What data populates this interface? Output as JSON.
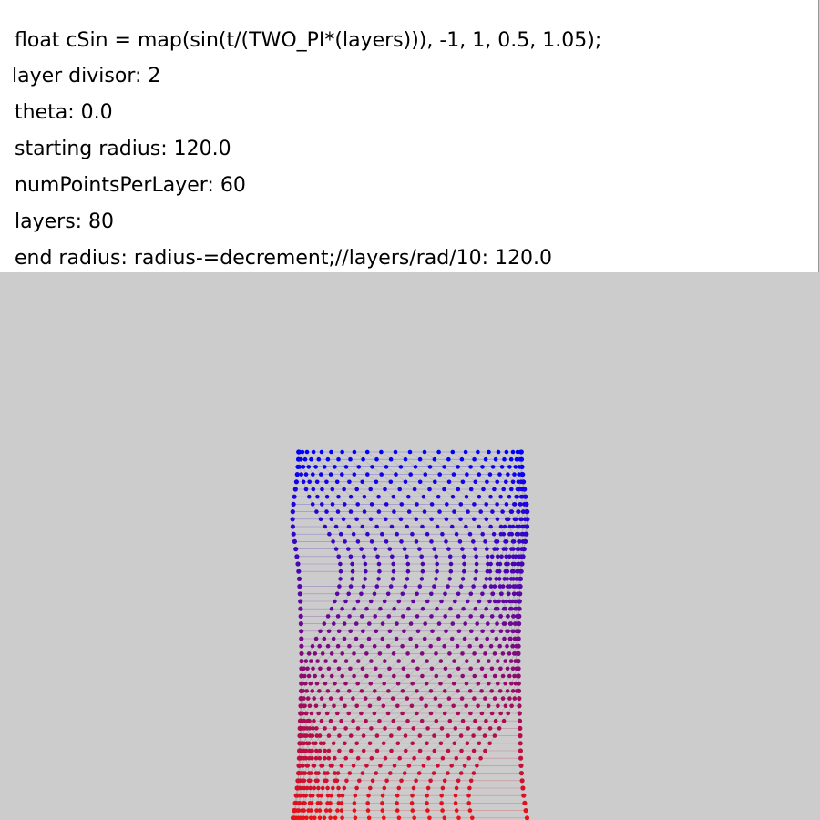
{
  "info_panel": {
    "lines": [
      "float cSin = map(sin(t/(TWO_PI*(layers))), -1, 1, 0.5, 1.05);",
      "layer divisor: 2",
      "theta: 0.0",
      "starting radius: 120.0",
      "numPointsPerLayer: 60",
      "layers: 80",
      "end radius: radius-=decrement;//layers/rad/10: 120.0"
    ]
  },
  "visualization": {
    "background_color": "#cccccc",
    "top_color": "#0000ff",
    "bottom_color": "#ee1111",
    "line_color": "#888888"
  }
}
